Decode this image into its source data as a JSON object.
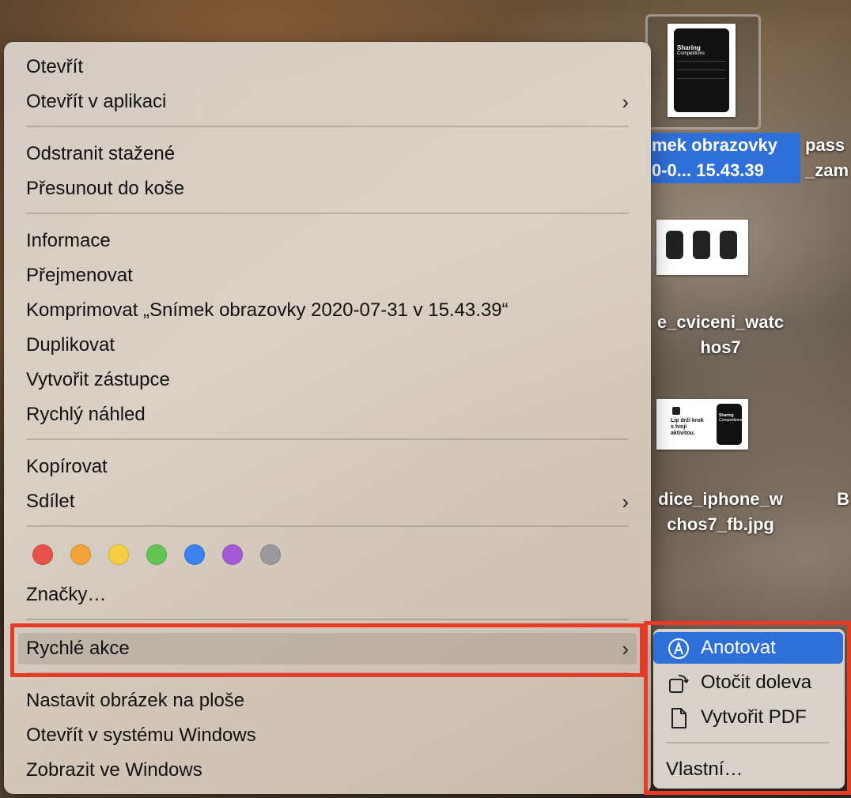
{
  "desktop": {
    "items": [
      {
        "label_line1": "mek obrazovky",
        "label_line2": "0-0... 15.43.39",
        "selected": true
      },
      {
        "label_line1": "pass",
        "label_line2": "_zam"
      },
      {
        "label_line1": "e_cviceni_watc",
        "label_line2": "hos7"
      },
      {
        "label_line1": "dice_iphone_w",
        "label_line2": "chos7_fb.jpg"
      },
      {
        "label_line1": "B"
      }
    ],
    "thumb1": {
      "title": "Sharing",
      "subtitle": "Competitions"
    },
    "thumb3": {
      "text": "Lip drží krok s tvojí aktivitou.",
      "mini_title": "Sharing",
      "mini_subtitle": "Competitions"
    }
  },
  "menu": {
    "open": "Otevřít",
    "open_with": "Otevřít v aplikaci",
    "remove_download": "Odstranit stažené",
    "move_to_trash": "Přesunout do koše",
    "get_info": "Informace",
    "rename": "Přejmenovat",
    "compress": "Komprimovat „Snímek obrazovky 2020-07-31 v 15.43.39“",
    "duplicate": "Duplikovat",
    "make_alias": "Vytvořit zástupce",
    "quick_look": "Rychlý náhled",
    "copy": "Kopírovat",
    "share": "Sdílet",
    "tags_label": "Značky…",
    "quick_actions": "Rychlé akce",
    "set_desktop": "Nastavit obrázek na ploše",
    "open_windows": "Otevřít v systému Windows",
    "show_windows": "Zobrazit ve Windows",
    "chevron": "›",
    "tag_colors": [
      "#e8524a",
      "#f2a33a",
      "#f5cf3f",
      "#62c554",
      "#3b82f0",
      "#a55bd6",
      "#9a9a9e"
    ]
  },
  "submenu": {
    "annotate": "Anotovat",
    "rotate_left": "Otočit doleva",
    "create_pdf": "Vytvořit PDF",
    "customize": "Vlastní…"
  },
  "colors": {
    "highlight": "#e63b26",
    "selection_blue": "#2f6fd8"
  }
}
